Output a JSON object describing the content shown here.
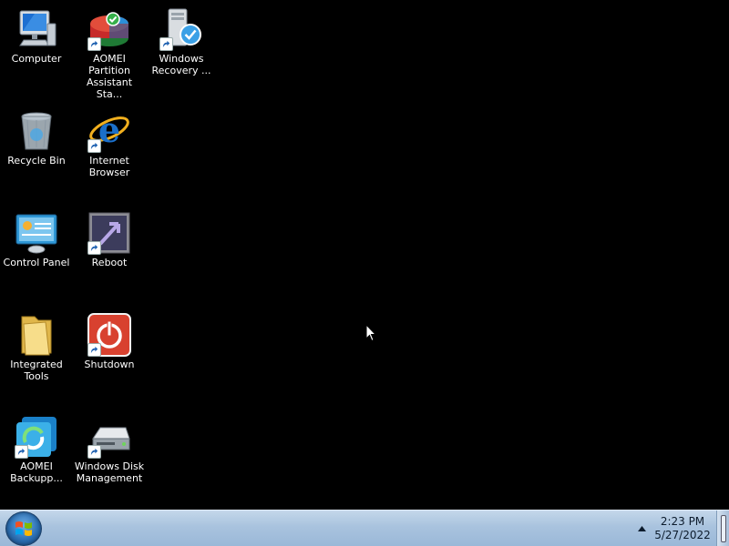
{
  "desktop": {
    "icons": [
      {
        "label": "Computer",
        "icon": "computer-icon"
      },
      {
        "label": "AOMEI Partition\nAssistant Sta...",
        "icon": "aomei-partition-icon"
      },
      {
        "label": "Windows\nRecovery ...",
        "icon": "windows-recovery-icon"
      },
      {
        "label": "Recycle Bin",
        "icon": "recycle-bin-icon"
      },
      {
        "label": "Internet\nBrowser",
        "icon": "internet-browser-icon"
      },
      {
        "label": "Control Panel",
        "icon": "control-panel-icon"
      },
      {
        "label": "Reboot",
        "icon": "reboot-icon"
      },
      {
        "label": "Integrated\nTools",
        "icon": "folder-icon"
      },
      {
        "label": "Shutdown",
        "icon": "shutdown-icon"
      },
      {
        "label": "AOMEI\nBackupp...",
        "icon": "aomei-backupper-icon"
      },
      {
        "label": "Windows Disk\nManagement",
        "icon": "disk-management-icon"
      }
    ]
  },
  "taskbar": {
    "start_icon": "windows-start-icon",
    "tray_icon": "show-hidden-icons-arrow",
    "time": "2:23 PM",
    "date": "5/27/2022"
  },
  "colors": {
    "desktop_bg": "#000000",
    "taskbar_bg": "#a9c3de",
    "label_color": "#ffffff"
  }
}
